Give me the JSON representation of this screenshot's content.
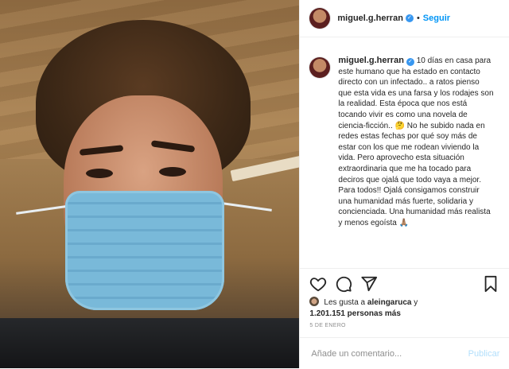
{
  "post": {
    "username": "miguel.g.herran",
    "verified": true,
    "follow_label": "Seguir",
    "separator": "•",
    "caption_text": "10 días en casa para este humano que ha estado en contacto directo con un infectado.. a ratos pienso que esta vida es una farsa y los rodajes son la realidad. Esta época que nos está tocando vivir es como una novela de ciencia-ficción.. 🤔 No he subido nada en redes estas fechas por qué soy más de estar con los que me rodean viviendo la vida. Pero aprovecho esta situación extraordinaria que me ha tocado para deciros que ojalá que todo vaya a mejor. Para todos!! Ojalá consigamos construir una humanidad más fuerte, solidaria y concienciada. Una humanidad más realista y menos egoísta 🙏🏽",
    "likes_prefix": "Les gusta a",
    "likes_user": "aleingaruca",
    "likes_mid": "y",
    "likes_count": "1.201.151 personas más",
    "date": "5 DE ENERO",
    "comment_placeholder": "Añade un comentario...",
    "publish_label": "Publicar"
  },
  "icons": {
    "verified": "verified-badge-icon",
    "like": "heart-icon",
    "comment": "comment-bubble-icon",
    "share": "paper-plane-icon",
    "save": "bookmark-icon"
  },
  "colors": {
    "link_blue": "#0095f6",
    "verified_blue": "#3897f0",
    "muted": "#8e8e8e",
    "publish_disabled": "#b2dffc"
  }
}
